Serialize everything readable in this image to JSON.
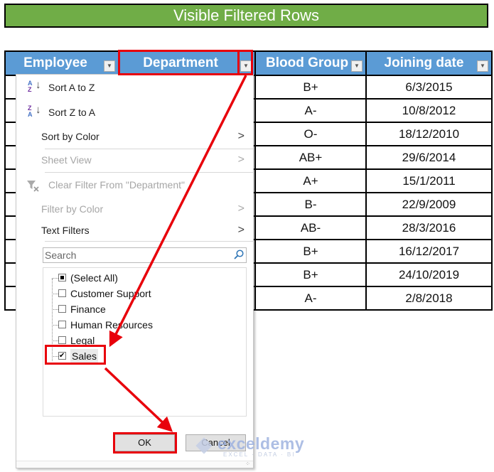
{
  "title": "Visible Filtered Rows",
  "table": {
    "headers": [
      "Employee",
      "Department",
      "Blood Group",
      "Joining date"
    ],
    "rows": [
      {
        "blood_group": "B+",
        "joining_date": "6/3/2015"
      },
      {
        "blood_group": "A-",
        "joining_date": "10/8/2012"
      },
      {
        "blood_group": "O-",
        "joining_date": "18/12/2010"
      },
      {
        "blood_group": "AB+",
        "joining_date": "29/6/2014"
      },
      {
        "blood_group": "A+",
        "joining_date": "15/1/2011"
      },
      {
        "blood_group": "B-",
        "joining_date": "22/9/2009"
      },
      {
        "blood_group": "AB-",
        "joining_date": "28/3/2016"
      },
      {
        "blood_group": "B+",
        "joining_date": "16/12/2017"
      },
      {
        "blood_group": "B+",
        "joining_date": "24/10/2019"
      },
      {
        "blood_group": "A-",
        "joining_date": "2/8/2018"
      }
    ]
  },
  "filter_menu": {
    "sort_az": "Sort A to Z",
    "sort_za": "Sort Z to A",
    "sort_by_color": "Sort by Color",
    "sheet_view": "Sheet View",
    "clear_filter": "Clear Filter From \"Department\"",
    "filter_by_color": "Filter by Color",
    "text_filters": "Text Filters",
    "search_placeholder": "Search",
    "items": [
      {
        "label": "(Select All)",
        "state": "indeterminate"
      },
      {
        "label": "Customer Support",
        "state": "unchecked"
      },
      {
        "label": "Finance",
        "state": "unchecked"
      },
      {
        "label": "Human Resources",
        "state": "unchecked"
      },
      {
        "label": "Legal",
        "state": "unchecked"
      },
      {
        "label": "Sales",
        "state": "checked"
      }
    ],
    "ok": "OK",
    "cancel": "Cancel"
  },
  "annotation_color": "#e8000b",
  "watermark": {
    "brand": "exceldemy",
    "tagline": "EXCEL · DATA · BI"
  }
}
